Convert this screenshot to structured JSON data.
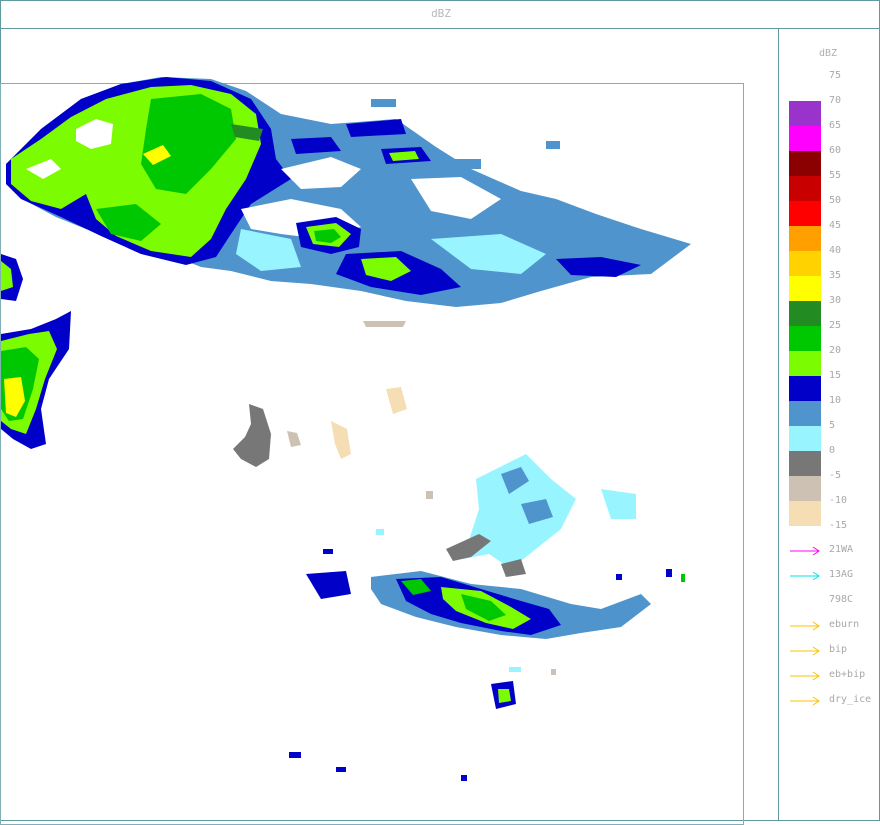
{
  "title": "dBZ",
  "legend": {
    "unit": "dBZ",
    "top_label": "75",
    "scale": [
      {
        "label": "70",
        "color": "#9933cc"
      },
      {
        "label": "65",
        "color": "#ff00ff"
      },
      {
        "label": "60",
        "color": "#8b0000"
      },
      {
        "label": "55",
        "color": "#c80000"
      },
      {
        "label": "50",
        "color": "#ff0000"
      },
      {
        "label": "45",
        "color": "#ffa000"
      },
      {
        "label": "40",
        "color": "#ffd200"
      },
      {
        "label": "35",
        "color": "#ffff00"
      },
      {
        "label": "30",
        "color": "#228b22"
      },
      {
        "label": "25",
        "color": "#00c800"
      },
      {
        "label": "20",
        "color": "#7cfc00"
      },
      {
        "label": "15",
        "color": "#0000c8"
      },
      {
        "label": "10",
        "color": "#4f94cd"
      },
      {
        "label": "5",
        "color": "#98f5ff"
      },
      {
        "label": "0",
        "color": "#777777"
      },
      {
        "label": "-5",
        "color": "#cdc1b4"
      },
      {
        "label": "-10",
        "color": "#f5deb3"
      }
    ],
    "bottom_label": "-15",
    "flights": [
      {
        "label": "21WA",
        "color": "#ff00ff",
        "arrow": true
      },
      {
        "label": "13AG",
        "color": "#00e5ee",
        "arrow": true
      },
      {
        "label": "798C",
        "color": "#aaaaaa",
        "arrow": false
      },
      {
        "label": "eburn",
        "color": "#ffc000",
        "arrow": true
      },
      {
        "label": "bip",
        "color": "#ffc000",
        "arrow": true
      },
      {
        "label": "eb+bip",
        "color": "#ffc000",
        "arrow": true
      },
      {
        "label": "dry_ice",
        "color": "#ffc000",
        "arrow": true
      }
    ]
  }
}
